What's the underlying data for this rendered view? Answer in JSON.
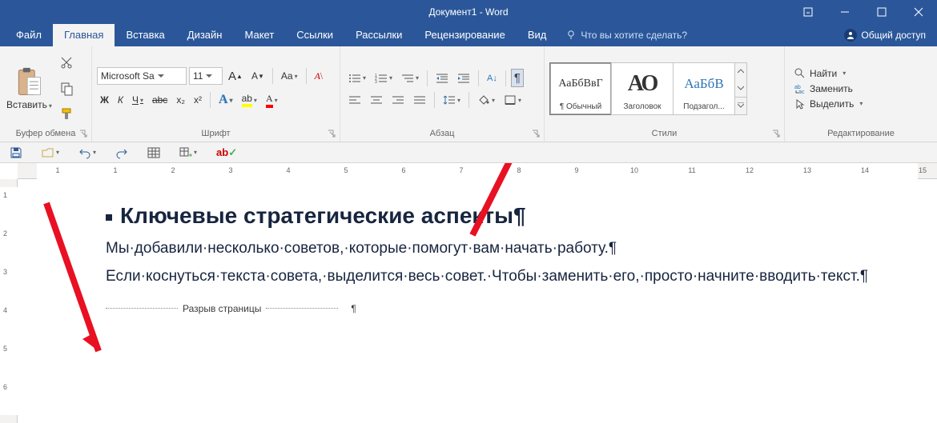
{
  "window": {
    "title": "Документ1 - Word"
  },
  "menu": {
    "file": "Файл",
    "home": "Главная",
    "insert": "Вставка",
    "design": "Дизайн",
    "layout": "Макет",
    "references": "Ссылки",
    "mailings": "Рассылки",
    "review": "Рецензирование",
    "view": "Вид",
    "tell_me": "Что вы хотите сделать?",
    "share": "Общий доступ"
  },
  "ribbon": {
    "clipboard": {
      "label": "Буфер обмена",
      "paste": "Вставить"
    },
    "font": {
      "label": "Шрифт",
      "name": "Microsoft Sa",
      "size": "11",
      "bold_glyph": "Ж",
      "italic_glyph": "К",
      "underline_glyph": "Ч",
      "increase": "A",
      "decrease": "A",
      "case": "Aa",
      "strike": "abc",
      "sub": "x₂",
      "sup": "x²",
      "texteffect": "A",
      "highlight": "ab",
      "color": "A"
    },
    "paragraph": {
      "label": "Абзац",
      "pilcrow": "¶",
      "sort": "А↓"
    },
    "styles": {
      "label": "Стили",
      "tile1_preview": "АаБбВвГ",
      "tile1_name": "¶ Обычный",
      "tile2_preview": "АО",
      "tile2_name": "Заголовок",
      "tile3_preview": "АаБбВ",
      "tile3_name": "Подзагол..."
    },
    "editing": {
      "label": "Редактирование",
      "find": "Найти",
      "replace": "Заменить",
      "select": "Выделить"
    }
  },
  "doc": {
    "heading": "Ключевые стратегические аспекты¶",
    "p1": "Мы·добавили·несколько·советов,·которые·помогут·вам·начать·работу.¶",
    "p2": "Если·коснуться·текста·совета,·выделится·весь·совет.·Чтобы·заменить·его,·просто·начните·вводить·текст.¶",
    "page_break": "Разрыв страницы",
    "pilcrow": "¶"
  },
  "ruler": {
    "h": [
      "1",
      "1",
      "2",
      "3",
      "4",
      "5",
      "6",
      "7",
      "8",
      "9",
      "10",
      "11",
      "12",
      "13",
      "14",
      "15"
    ],
    "v": [
      "1",
      "2",
      "3",
      "4",
      "5",
      "6"
    ]
  }
}
